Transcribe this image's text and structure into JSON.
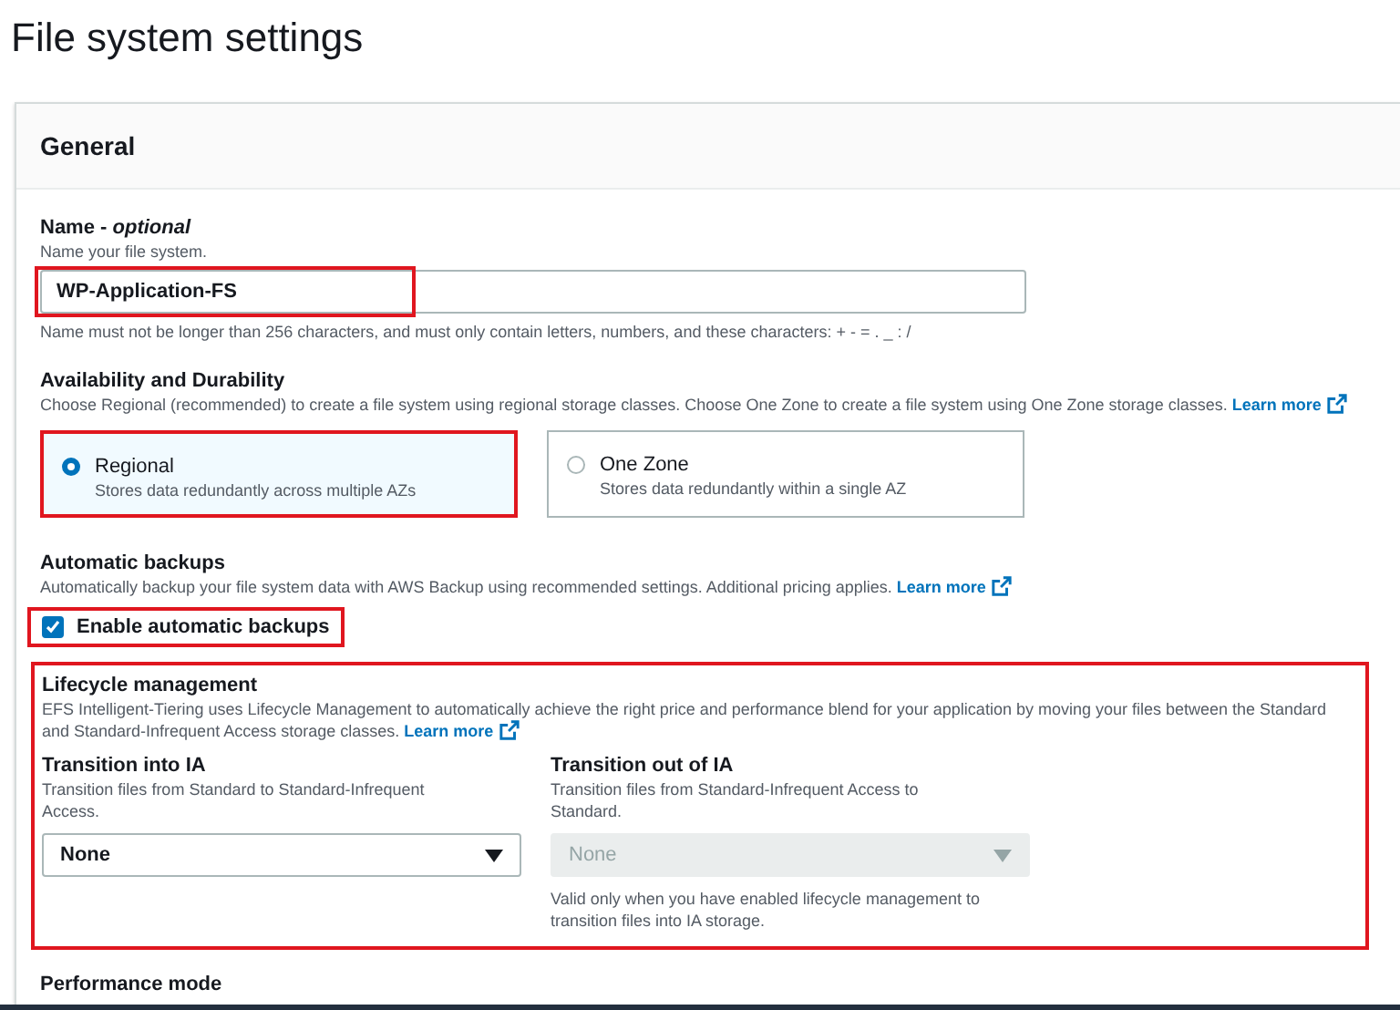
{
  "page_title": "File system settings",
  "panel": {
    "title": "General"
  },
  "name_field": {
    "label": "Name - *optional*",
    "description": "Name your file system.",
    "value": "WP-Application-FS",
    "highlighted": true,
    "constraint": "Name must not be longer than 256 characters, and must only contain letters, numbers, and these characters: + - = . _ : /"
  },
  "availability": {
    "label": "Availability and Durability",
    "description": "Choose Regional (recommended) to create a file system using regional storage classes. Choose One Zone to create a file system using One Zone storage classes.",
    "link": "Learn more",
    "options": [
      {
        "title": "Regional",
        "description": "Stores data redundantly across multiple AZs",
        "selected": true,
        "highlighted": true
      },
      {
        "title": "One Zone",
        "description": "Stores data redundantly within a single AZ",
        "selected": false,
        "highlighted": false
      }
    ]
  },
  "backups": {
    "label": "Automatic backups",
    "description": "Automatically backup your file system data with AWS Backup using recommended settings. Additional pricing applies.",
    "link": "Learn more",
    "checkbox": {
      "label": "Enable automatic backups",
      "checked": true,
      "highlighted": true
    }
  },
  "lifecycle": {
    "label": "Lifecycle management",
    "highlighted": true,
    "description": "EFS Intelligent-Tiering uses Lifecycle Management to automatically achieve the right price and performance blend for your application by moving your files between the Standard and Standard-Infrequent Access storage classes.",
    "link": "Learn more",
    "fields": [
      {
        "label": "Transition into IA",
        "description": "Transition files from Standard to Standard-Infrequent Access.",
        "value": "None",
        "disabled": false
      },
      {
        "label": "Transition out of IA",
        "description": "Transition files from Standard-Infrequent Access to Standard.",
        "value": "None",
        "disabled": true,
        "note": "Valid only when you have enabled lifecycle management to transition files into IA storage."
      }
    ]
  },
  "next_section": {
    "label": "Performance mode"
  }
}
